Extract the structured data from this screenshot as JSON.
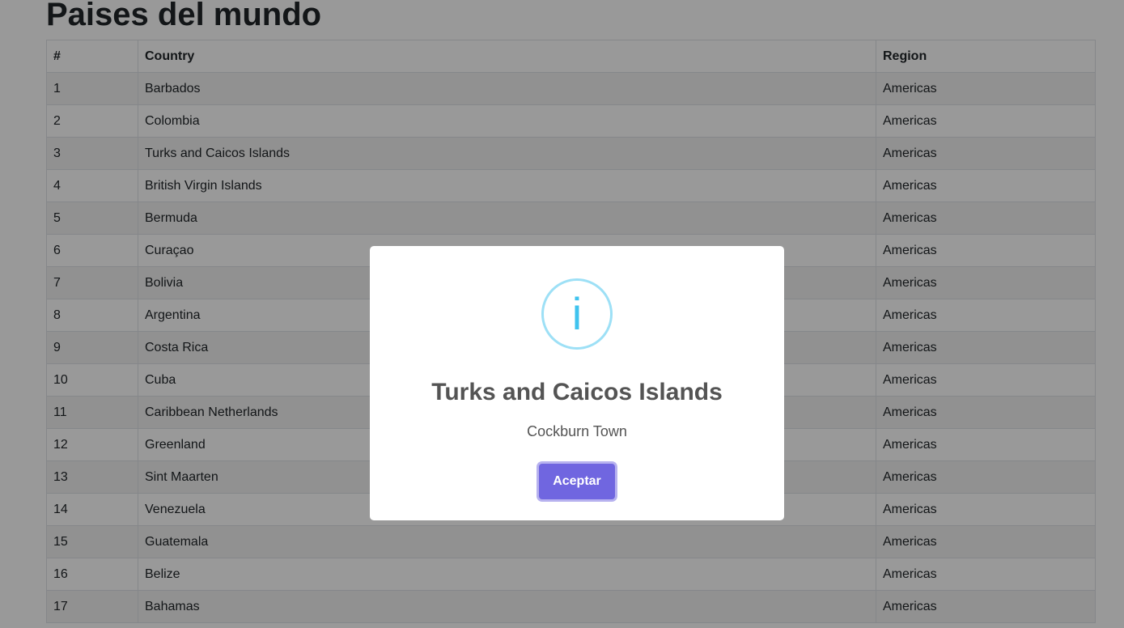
{
  "page": {
    "title": "Paises del mundo"
  },
  "table": {
    "headers": {
      "num": "#",
      "country": "Country",
      "region": "Region"
    },
    "rows": [
      {
        "num": "1",
        "country": "Barbados",
        "region": "Americas"
      },
      {
        "num": "2",
        "country": "Colombia",
        "region": "Americas"
      },
      {
        "num": "3",
        "country": "Turks and Caicos Islands",
        "region": "Americas"
      },
      {
        "num": "4",
        "country": "British Virgin Islands",
        "region": "Americas"
      },
      {
        "num": "5",
        "country": "Bermuda",
        "region": "Americas"
      },
      {
        "num": "6",
        "country": "Curaçao",
        "region": "Americas"
      },
      {
        "num": "7",
        "country": "Bolivia",
        "region": "Americas"
      },
      {
        "num": "8",
        "country": "Argentina",
        "region": "Americas"
      },
      {
        "num": "9",
        "country": "Costa Rica",
        "region": "Americas"
      },
      {
        "num": "10",
        "country": "Cuba",
        "region": "Americas"
      },
      {
        "num": "11",
        "country": "Caribbean Netherlands",
        "region": "Americas"
      },
      {
        "num": "12",
        "country": "Greenland",
        "region": "Americas"
      },
      {
        "num": "13",
        "country": "Sint Maarten",
        "region": "Americas"
      },
      {
        "num": "14",
        "country": "Venezuela",
        "region": "Americas"
      },
      {
        "num": "15",
        "country": "Guatemala",
        "region": "Americas"
      },
      {
        "num": "16",
        "country": "Belize",
        "region": "Americas"
      },
      {
        "num": "17",
        "country": "Bahamas",
        "region": "Americas"
      }
    ]
  },
  "modal": {
    "icon": "info-icon",
    "icon_glyph": "i",
    "title": "Turks and Caicos Islands",
    "text": "Cockburn Town",
    "confirm_label": "Aceptar"
  },
  "colors": {
    "confirm_button": "#7066e0",
    "info_icon_border": "#9de0f6",
    "info_icon_glyph": "#3fc3ee",
    "modal_text": "#545454"
  }
}
